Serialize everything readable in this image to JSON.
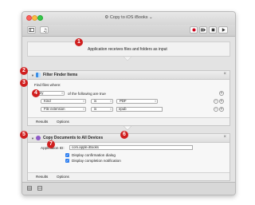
{
  "window": {
    "title": "Copy to iOS iBooks",
    "title_glyph": "⚙",
    "title_suffix": "⌄"
  },
  "toolbar": {
    "icons": [
      "sidebar-icon",
      "library-icon",
      "record-icon",
      "step-icon",
      "stop-icon",
      "run-icon"
    ]
  },
  "banner": {
    "text": "Application receives files and folders as input"
  },
  "filter_action": {
    "title": "Filter Finder Items",
    "find_label": "Find files where:",
    "any_value": "Any",
    "following_text": "of the following are true",
    "rows": [
      {
        "field": "Kind",
        "operator": "is",
        "value": "PDF"
      },
      {
        "field": "File extension",
        "operator": "is",
        "value": "epub"
      }
    ],
    "tabs": [
      "Results",
      "Options"
    ]
  },
  "copy_action": {
    "title": "Copy Documents to All Devices",
    "app_id_label": "Application ID:",
    "app_id_value": "com.apple.iBooks",
    "checkbox_1": "Display confirmation dialog",
    "checkbox_2": "Display completion notification",
    "tabs": [
      "Results",
      "Options"
    ]
  },
  "markers": [
    "1",
    "2",
    "3",
    "4",
    "5",
    "6",
    "7"
  ],
  "colors": {
    "marker": "#d01f1f",
    "checkbox": "#2f7ff0",
    "record": "#d0021b"
  }
}
